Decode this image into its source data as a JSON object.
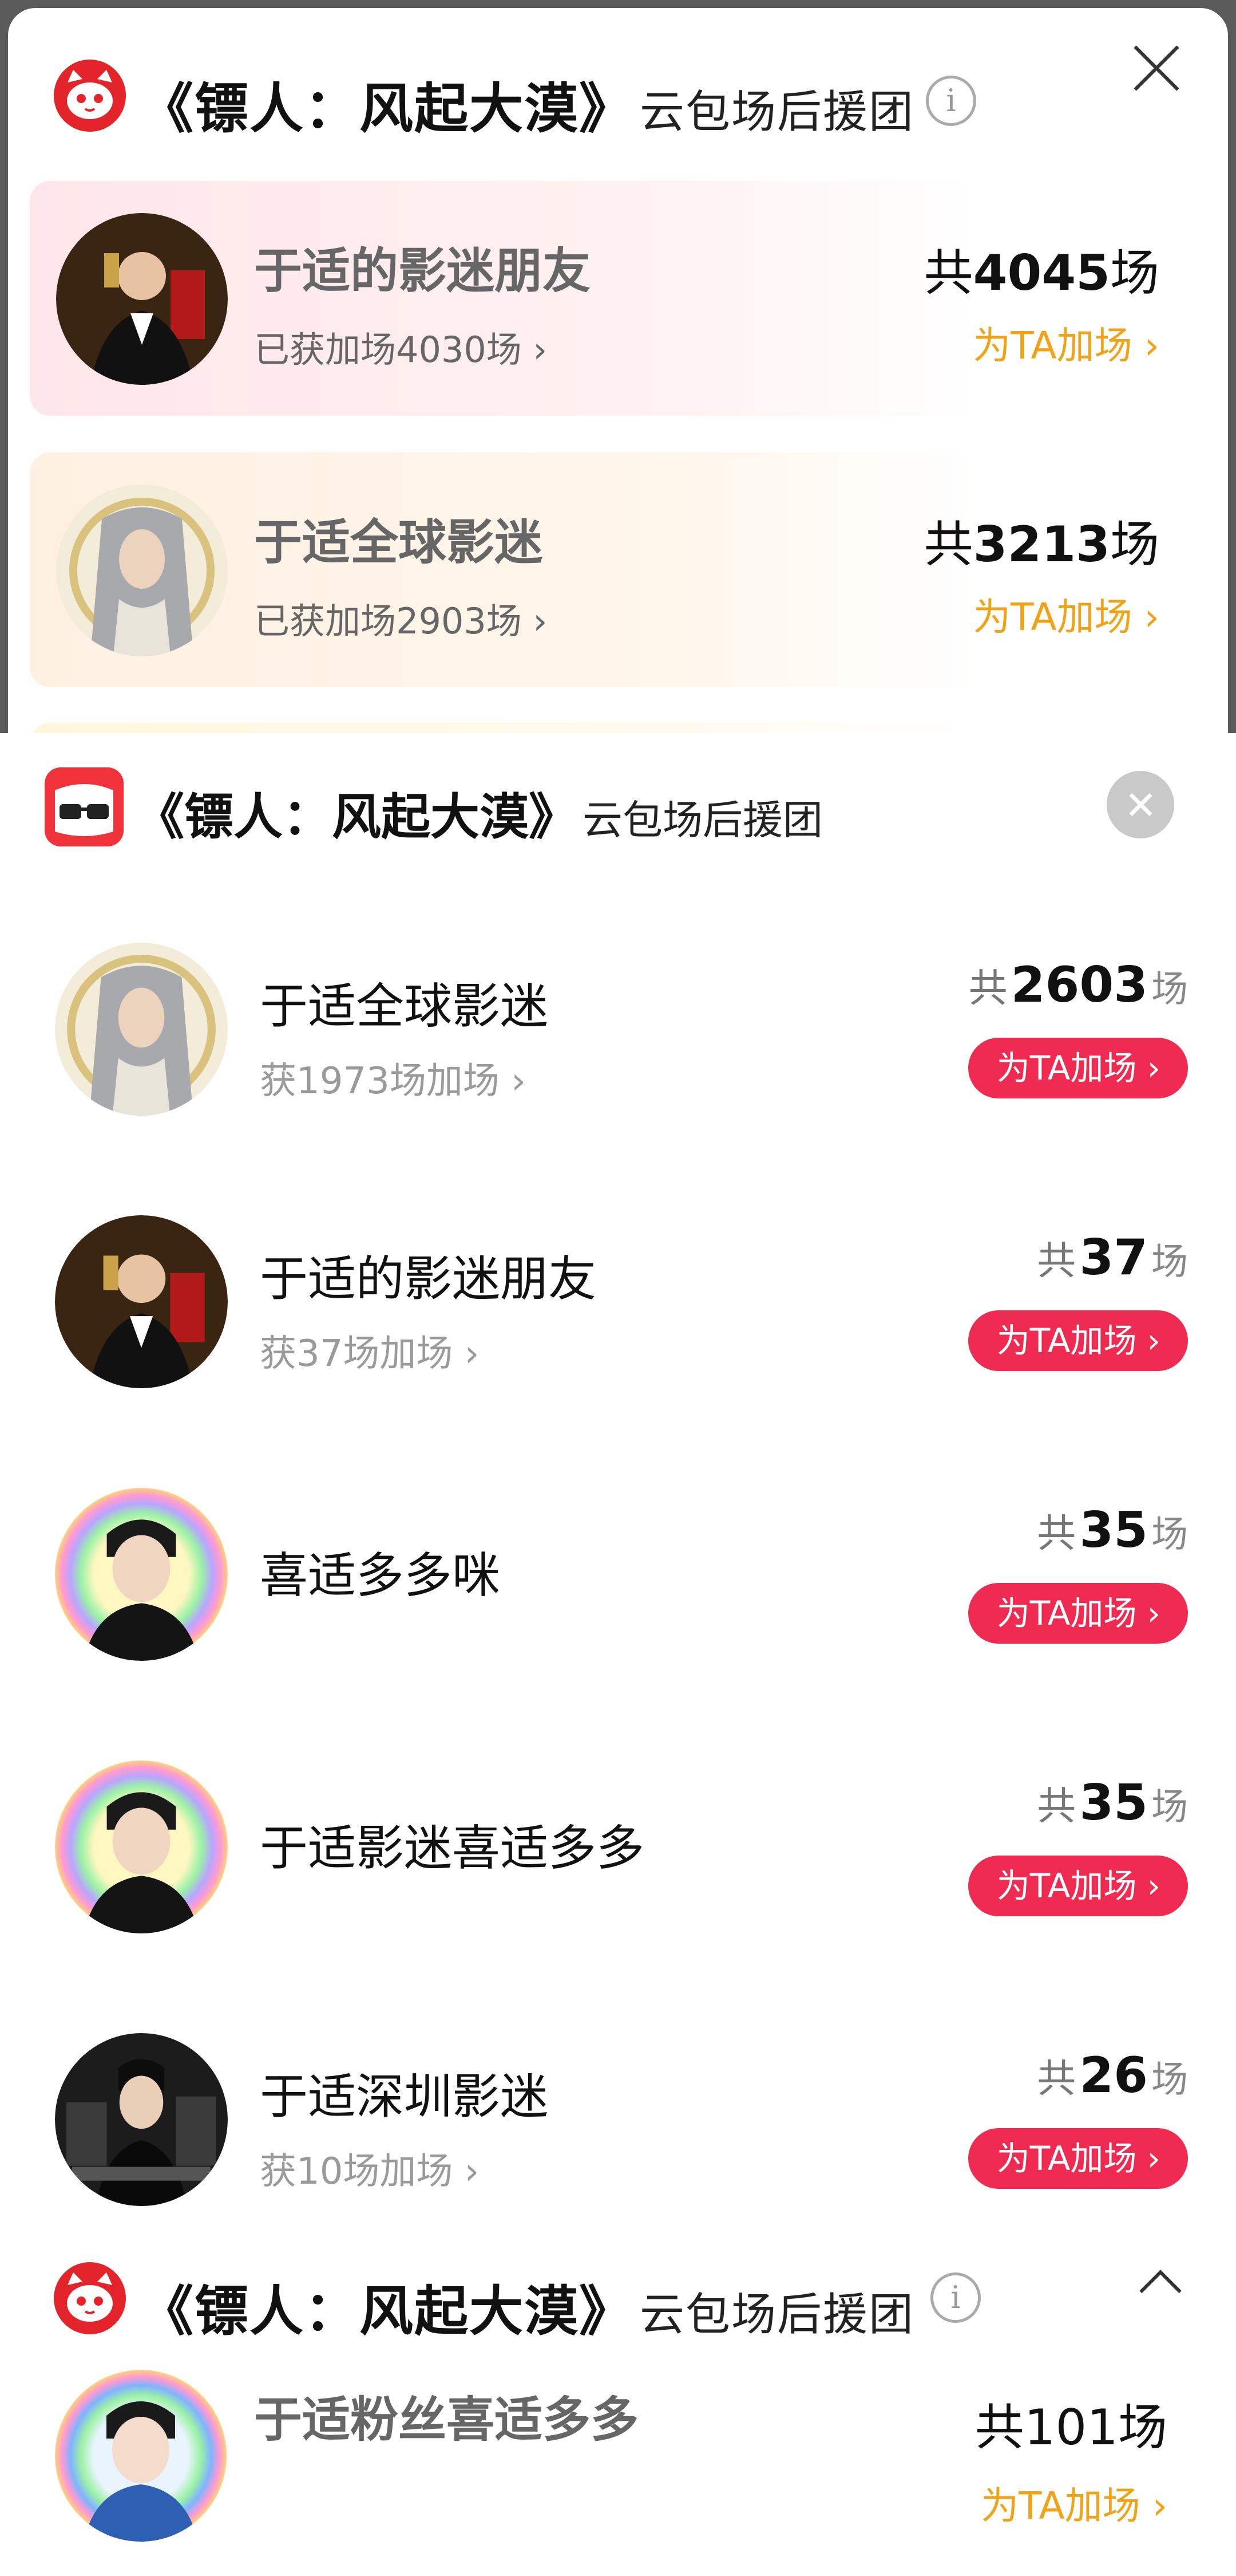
{
  "panel_a": {
    "title": "《镖人：风起大漠》",
    "subtitle": "云包场后援团",
    "info_icon": "i",
    "rows": [
      {
        "name": "于适的影迷朋友",
        "got": "已获加场4030场 ›",
        "total_prefix": "共",
        "total_num": "4045",
        "total_suffix": "场",
        "boost": "为TA加场 ›"
      },
      {
        "name": "于适全球影迷",
        "got": "已获加场2903场 ›",
        "total_prefix": "共",
        "total_num": "3213",
        "total_suffix": "场",
        "boost": "为TA加场 ›"
      }
    ]
  },
  "panel_b": {
    "title": "《镖人：风起大漠》",
    "subtitle": "云包场后援团",
    "rows": [
      {
        "name": "于适全球影迷",
        "got": "获1973场加场 ›",
        "total_prefix": "共",
        "total_num": "2603",
        "total_suffix": "场",
        "boost": "为TA加场 ›"
      },
      {
        "name": "于适的影迷朋友",
        "got": "获37场加场 ›",
        "total_prefix": "共",
        "total_num": "37",
        "total_suffix": "场",
        "boost": "为TA加场 ›"
      },
      {
        "name": "喜适多多咪",
        "got": "",
        "total_prefix": "共",
        "total_num": "35",
        "total_suffix": "场",
        "boost": "为TA加场 ›"
      },
      {
        "name": "于适影迷喜适多多",
        "got": "",
        "total_prefix": "共",
        "total_num": "35",
        "total_suffix": "场",
        "boost": "为TA加场 ›"
      },
      {
        "name": "于适深圳影迷",
        "got": "获10场加场 ›",
        "total_prefix": "共",
        "total_num": "26",
        "total_suffix": "场",
        "boost": "为TA加场 ›"
      }
    ]
  },
  "panel_c": {
    "title": "《镖人：风起大漠》",
    "subtitle": "云包场后援团",
    "info_icon": "i",
    "row": {
      "name": "于适粉丝喜适多多",
      "total_prefix": "共",
      "total_num": "101",
      "total_suffix": "场",
      "boost": "为TA加场 ›"
    }
  },
  "colors": {
    "maoyan_red": "#e4242b",
    "boost_orange": "#f0a316",
    "button_red": "#ef2b52"
  },
  "icons": [
    "maoyan-cat-logo-icon",
    "info-icon",
    "close-icon",
    "taopiaopiao-logo-icon",
    "chevron-up-icon"
  ]
}
